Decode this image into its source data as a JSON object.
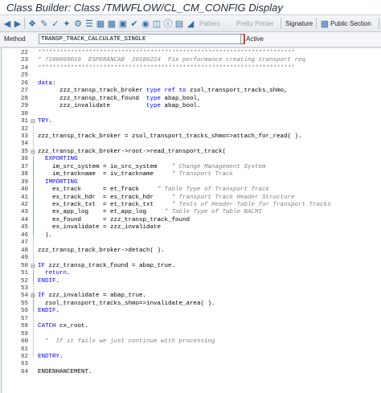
{
  "window": {
    "title": "Class Builder: Class /TMWFLOW/CL_CM_CONFIG Display"
  },
  "toolbar": {
    "pattern_label": "Pattern",
    "pretty_printer_label": "Pretty Printer",
    "signature_label": "Signature",
    "public_section_label": "Public Section"
  },
  "method_bar": {
    "label": "Method",
    "value": "TRANSP_TRACK_CALCULATE_SINGLE",
    "status": "Active"
  },
  "editor": {
    "lines": [
      {
        "n": "22",
        "f": "",
        "ind": "",
        "s": [
          [
            "cm",
            "*\"*********************************************************************"
          ]
        ]
      },
      {
        "n": "23",
        "f": "",
        "ind": "",
        "s": [
          [
            "cm",
            "* 7100009016  ESPERANCAB  20180224  Fix performance creating transport req"
          ]
        ]
      },
      {
        "n": "24",
        "f": "",
        "ind": "",
        "s": [
          [
            "cm",
            "*\"*********************************************************************"
          ]
        ]
      },
      {
        "n": "25",
        "f": "",
        "ind": "",
        "s": []
      },
      {
        "n": "26",
        "f": "",
        "ind": "",
        "s": [
          [
            "kw",
            "data"
          ],
          [
            "nm",
            ":"
          ]
        ]
      },
      {
        "n": "27",
        "f": "",
        "ind": "",
        "s": [
          [
            "nm",
            "      zzz_transp_track_broker "
          ],
          [
            "kw",
            "type ref to"
          ],
          [
            "nm",
            " zsol_transport_tracks_shmo,"
          ]
        ]
      },
      {
        "n": "28",
        "f": "",
        "ind": "",
        "s": [
          [
            "nm",
            "      zzz_transp_track_found  "
          ],
          [
            "kw",
            "type"
          ],
          [
            "nm",
            " abap_bool,"
          ]
        ]
      },
      {
        "n": "29",
        "f": "",
        "ind": "",
        "s": [
          [
            "nm",
            "      zzz_invalidate          "
          ],
          [
            "kw",
            "type"
          ],
          [
            "nm",
            " abap_bool."
          ]
        ]
      },
      {
        "n": "30",
        "f": "",
        "ind": "",
        "s": []
      },
      {
        "n": "31",
        "f": "⊟",
        "ind": "",
        "s": [
          [
            "kw",
            "TRY"
          ],
          [
            "nm",
            "."
          ]
        ]
      },
      {
        "n": "32",
        "f": "",
        "ind": "",
        "s": []
      },
      {
        "n": "33",
        "f": "",
        "ind": "",
        "s": [
          [
            "nm",
            "zzz_transp_track_broker = zsol_transport_tracks_shmo=>attach_for_read( )."
          ]
        ]
      },
      {
        "n": "34",
        "f": "",
        "ind": "",
        "s": []
      },
      {
        "n": "35",
        "f": "⊟",
        "ind": "",
        "s": [
          [
            "nm",
            "zzz_transp_track_broker->root->read_transport_track("
          ]
        ]
      },
      {
        "n": "36",
        "f": "",
        "ind": "",
        "s": [
          [
            "kw",
            "  EXPORTING"
          ]
        ]
      },
      {
        "n": "37",
        "f": "",
        "ind": "",
        "s": [
          [
            "nm",
            "    im_src_system = io_src_system    "
          ],
          [
            "cm",
            "\" Change Management System"
          ]
        ]
      },
      {
        "n": "38",
        "f": "",
        "ind": "",
        "s": [
          [
            "nm",
            "    im_trackname  = iv_trackname     "
          ],
          [
            "cm",
            "\" Transport Track"
          ]
        ]
      },
      {
        "n": "39",
        "f": "",
        "ind": "",
        "s": [
          [
            "kw",
            "  IMPORTING"
          ]
        ]
      },
      {
        "n": "40",
        "f": "",
        "ind": "",
        "s": [
          [
            "nm",
            "    ex_track      = et_Track     "
          ],
          [
            "cm",
            "\" Table Type of Transport Track"
          ]
        ]
      },
      {
        "n": "41",
        "f": "",
        "ind": "",
        "s": [
          [
            "nm",
            "    ex_track_hdr  = es_track_hdr     "
          ],
          [
            "cm",
            "\" Transport Track Header Structure"
          ]
        ]
      },
      {
        "n": "42",
        "f": "",
        "ind": "",
        "s": [
          [
            "nm",
            "    ex_track_txt  = et_track_txt     "
          ],
          [
            "cm",
            "\" Texts of Header Table for Transport Tracks"
          ]
        ]
      },
      {
        "n": "43",
        "f": "",
        "ind": "",
        "s": [
          [
            "nm",
            "    ex_app_log    = et_app_log     "
          ],
          [
            "cm",
            "\" Table Type of Table BALMI"
          ]
        ]
      },
      {
        "n": "44",
        "f": "",
        "ind": "",
        "s": [
          [
            "nm",
            "    ex_found      = zzz_transp_track_found"
          ]
        ]
      },
      {
        "n": "45",
        "f": "",
        "ind": "",
        "s": [
          [
            "nm",
            "    ex_invalidate = zzz_invalidate"
          ]
        ]
      },
      {
        "n": "46",
        "f": "",
        "ind": "",
        "s": [
          [
            "nm",
            "  )."
          ]
        ]
      },
      {
        "n": "47",
        "f": "",
        "ind": "",
        "s": []
      },
      {
        "n": "48",
        "f": "",
        "ind": "",
        "s": [
          [
            "nm",
            "zzz_transp_track_broker->detach( )."
          ]
        ]
      },
      {
        "n": "49",
        "f": "",
        "ind": "",
        "s": []
      },
      {
        "n": "50",
        "f": "⊟",
        "ind": "",
        "s": [
          [
            "kw",
            "IF"
          ],
          [
            "nm",
            " zzz_transp_track_found = abap_true."
          ]
        ]
      },
      {
        "n": "51",
        "f": "",
        "ind": "",
        "s": [
          [
            "kw",
            "  return"
          ],
          [
            "nm",
            "."
          ]
        ]
      },
      {
        "n": "52",
        "f": "",
        "ind": "",
        "s": [
          [
            "kw",
            "ENDIF"
          ],
          [
            "nm",
            "."
          ]
        ]
      },
      {
        "n": "53",
        "f": "",
        "ind": "",
        "s": []
      },
      {
        "n": "54",
        "f": "⊟",
        "ind": "",
        "s": [
          [
            "kw",
            "IF"
          ],
          [
            "nm",
            " zzz_invalidate = abap_true."
          ]
        ]
      },
      {
        "n": "55",
        "f": "",
        "ind": "",
        "s": [
          [
            "nm",
            "  zsol_transport_tracks_shmo=>invalidate_area( )."
          ]
        ]
      },
      {
        "n": "56",
        "f": "",
        "ind": "",
        "s": [
          [
            "kw",
            "ENDIF"
          ],
          [
            "nm",
            "."
          ]
        ]
      },
      {
        "n": "57",
        "f": "",
        "ind": "",
        "s": []
      },
      {
        "n": "58",
        "f": "",
        "ind": "",
        "s": [
          [
            "kw",
            "CATCH"
          ],
          [
            "nm",
            " cx_root."
          ]
        ]
      },
      {
        "n": "59",
        "f": "",
        "ind": "",
        "s": []
      },
      {
        "n": "60",
        "f": "",
        "ind": "",
        "s": [
          [
            "cm",
            "  *  If it fails we just continue with processing"
          ]
        ]
      },
      {
        "n": "61",
        "f": "",
        "ind": "",
        "s": []
      },
      {
        "n": "62",
        "f": "",
        "ind": "",
        "s": [
          [
            "kw",
            "ENDTRY"
          ],
          [
            "nm",
            "."
          ]
        ]
      },
      {
        "n": "63",
        "f": "",
        "ind": "",
        "s": []
      },
      {
        "n": "64",
        "f": "",
        "ind": "",
        "s": [
          [
            "nm",
            "ENDENHANCEMENT."
          ]
        ]
      }
    ]
  },
  "colors": {
    "keyword": "#0000ff",
    "comment": "#808080",
    "code": "#000000"
  },
  "icons": {
    "back": "left-arrow-icon",
    "forward": "right-arrow-icon",
    "edit": "pencil-icon",
    "activate": "activate-icon",
    "signature": "signature-icon",
    "public_section": "class-icon"
  }
}
